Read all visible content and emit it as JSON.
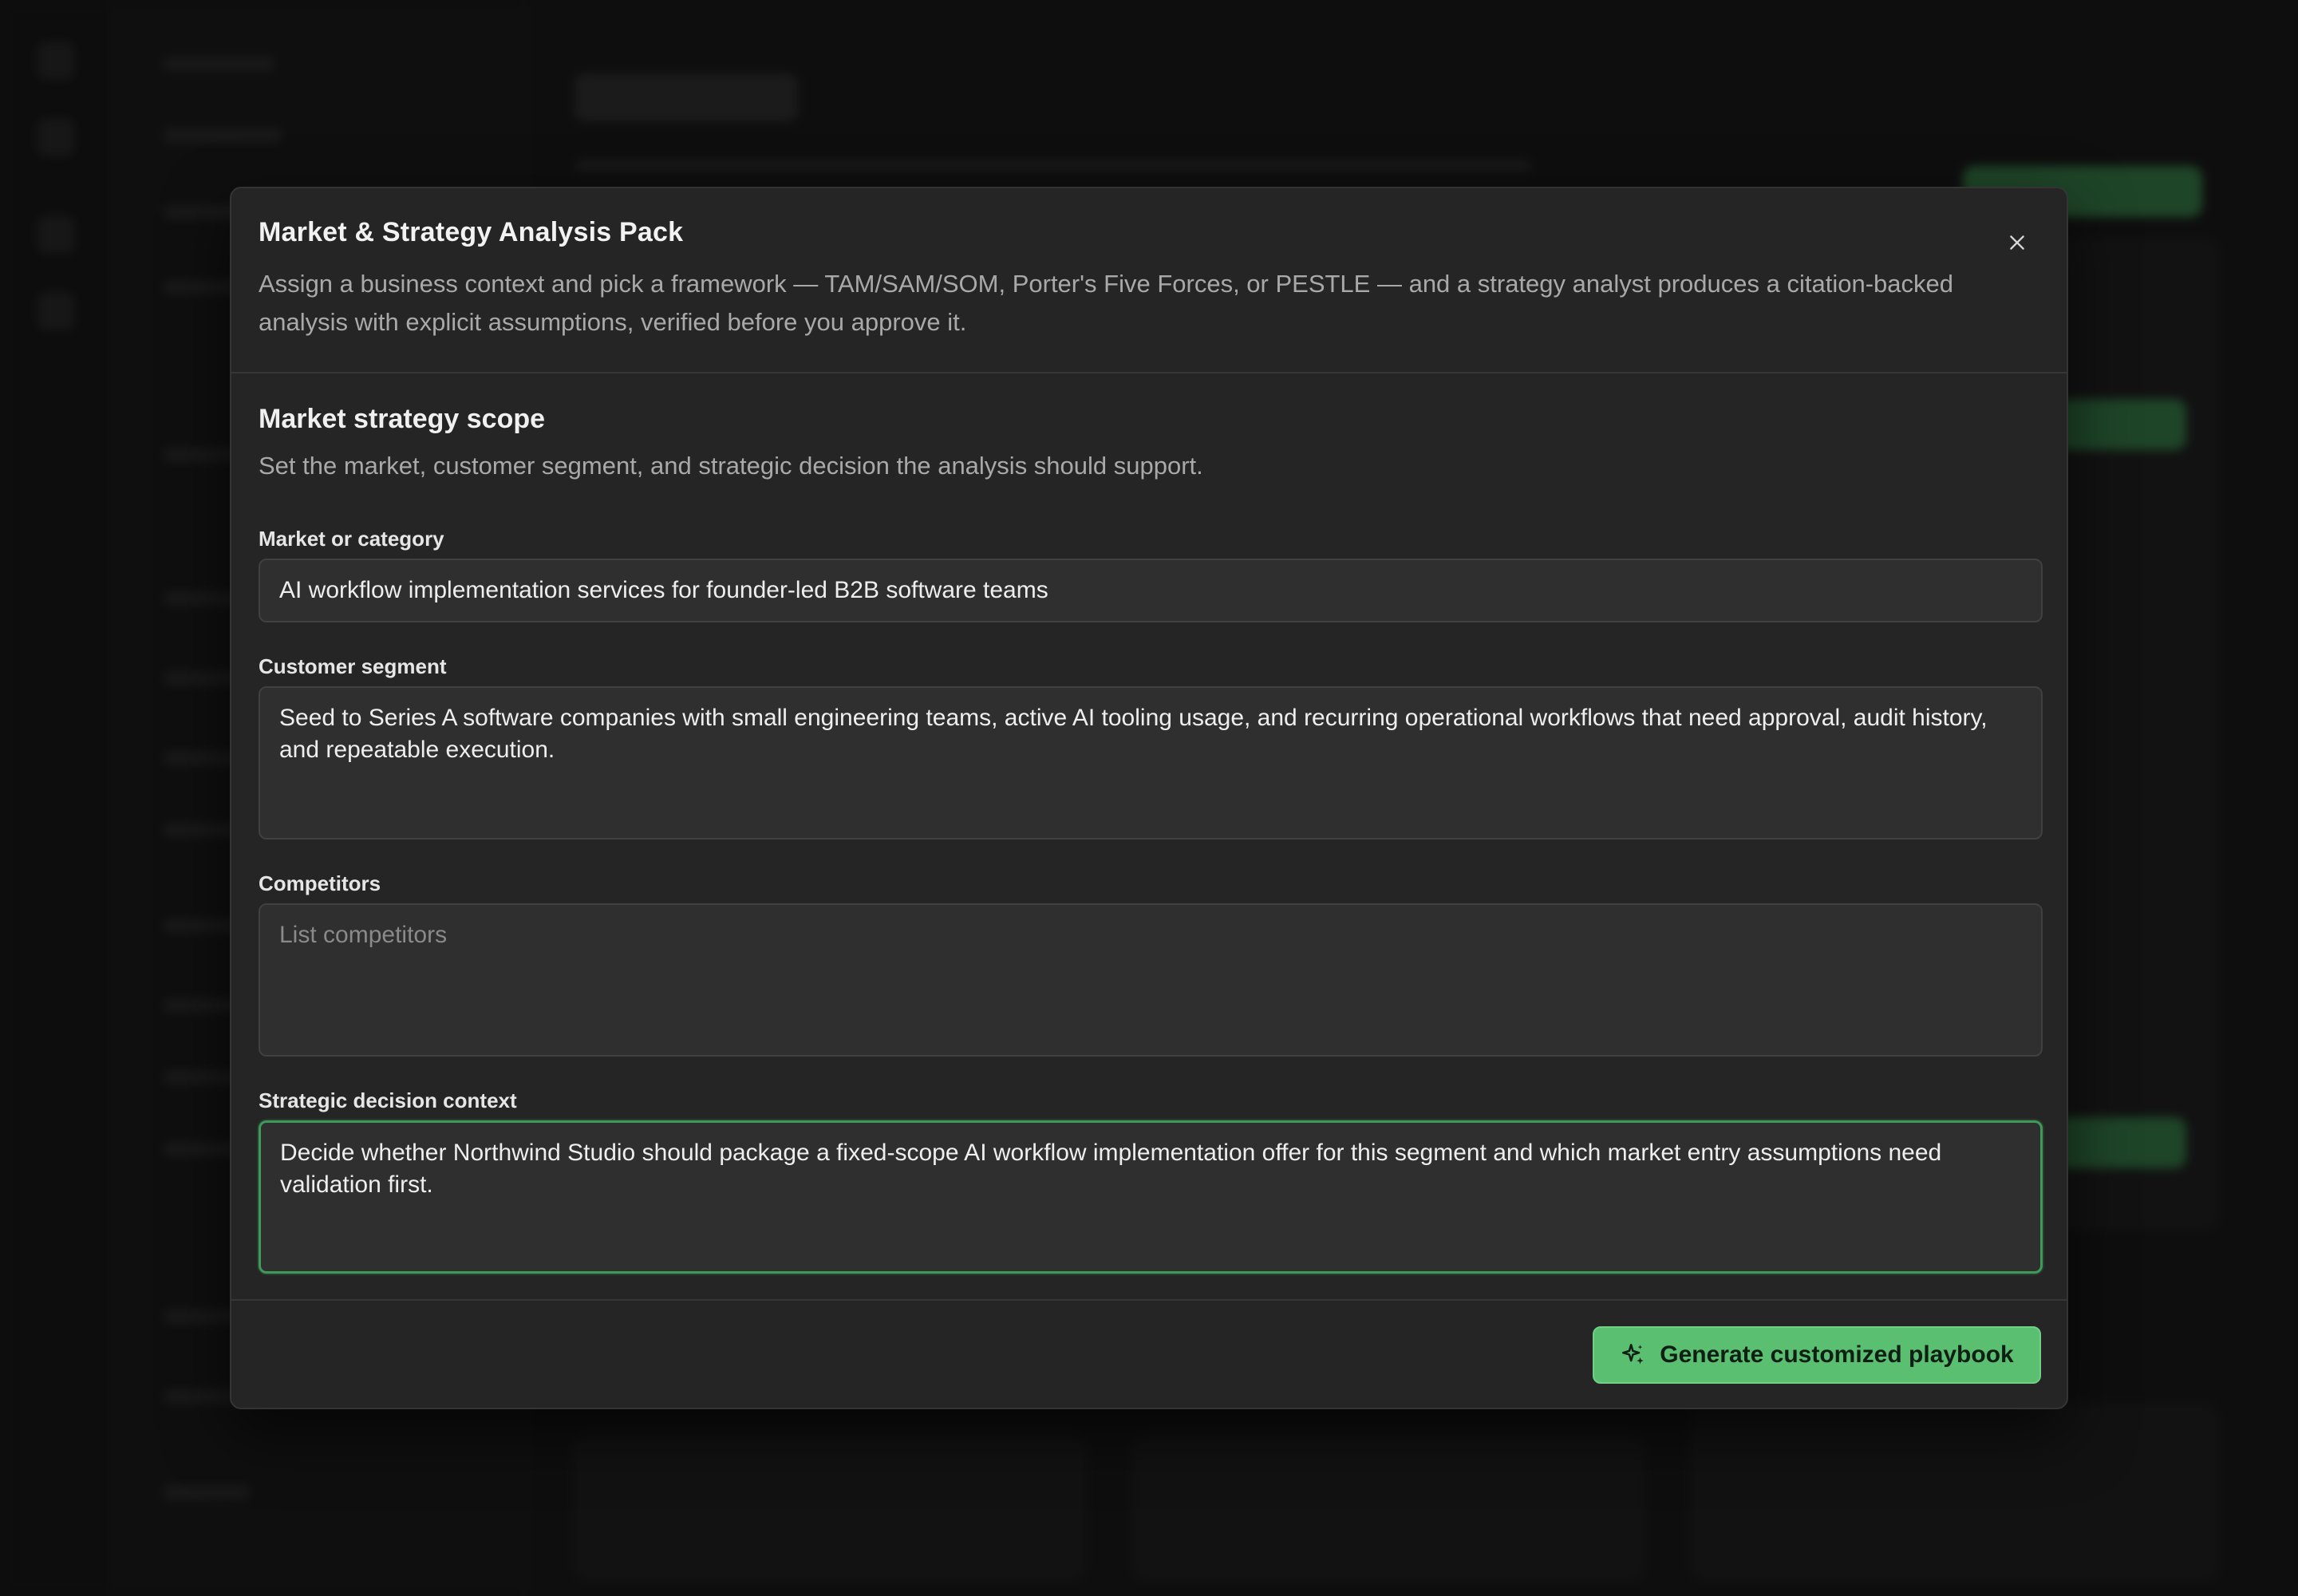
{
  "modal": {
    "title": "Market & Strategy Analysis Pack",
    "description": "Assign a business context and pick a framework — TAM/SAM/SOM, Porter's Five Forces, or PESTLE — and a strategy analyst produces a citation-backed analysis with explicit assumptions, verified before you approve it.",
    "close_icon": "close-icon"
  },
  "section": {
    "title": "Market strategy scope",
    "description": "Set the market, customer segment, and strategic decision the analysis should support."
  },
  "fields": {
    "market": {
      "label": "Market or category",
      "value": "AI workflow implementation services for founder-led B2B software teams"
    },
    "segment": {
      "label": "Customer segment",
      "value": "Seed to Series A software companies with small engineering teams, active AI tooling usage, and recurring operational workflows that need approval, audit history, and repeatable execution."
    },
    "competitors": {
      "label": "Competitors",
      "value": "",
      "placeholder": "List competitors"
    },
    "decision": {
      "label": "Strategic decision context",
      "value": "Decide whether Northwind Studio should package a fixed-scope AI workflow implementation offer for this segment and which market entry assumptions need validation first."
    }
  },
  "footer": {
    "generate_label": "Generate customized playbook",
    "generate_icon": "sparkles-icon"
  },
  "colors": {
    "accent": "#5bbf72",
    "focus_border": "#3f9a5a",
    "modal_bg": "#252525",
    "input_bg": "#2f2f2f"
  }
}
